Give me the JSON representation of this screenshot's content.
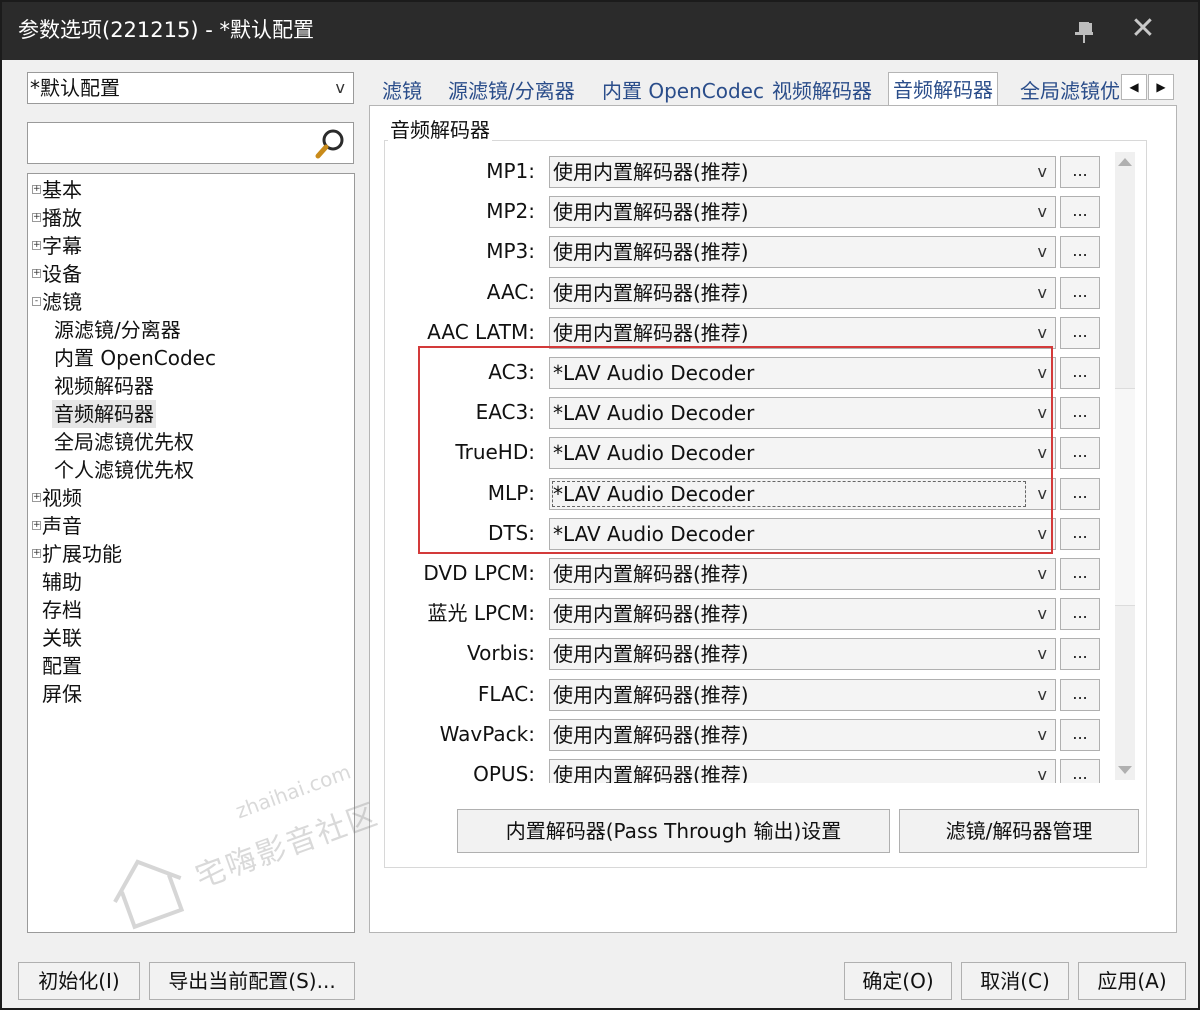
{
  "window": {
    "title": "参数选项(221215) - *默认配置"
  },
  "profile": {
    "selected": "*默认配置"
  },
  "search": {
    "placeholder": "",
    "value": ""
  },
  "tree": {
    "items": [
      {
        "label": "基本"
      },
      {
        "label": "播放"
      },
      {
        "label": "字幕"
      },
      {
        "label": "设备"
      },
      {
        "label": "滤镜"
      },
      {
        "label": "源滤镜/分离器"
      },
      {
        "label": "内置 OpenCodec"
      },
      {
        "label": "视频解码器"
      },
      {
        "label": "音频解码器"
      },
      {
        "label": "全局滤镜优先权"
      },
      {
        "label": "个人滤镜优先权"
      },
      {
        "label": "视频"
      },
      {
        "label": "声音"
      },
      {
        "label": "扩展功能"
      },
      {
        "label": "辅助"
      },
      {
        "label": "存档"
      },
      {
        "label": "关联"
      },
      {
        "label": "配置"
      },
      {
        "label": "屏保"
      }
    ]
  },
  "tabs": [
    {
      "label": "滤镜"
    },
    {
      "label": "源滤镜/分离器"
    },
    {
      "label": "内置 OpenCodec"
    },
    {
      "label": "视频解码器"
    },
    {
      "label": "音频解码器"
    },
    {
      "label": "全局滤镜优"
    }
  ],
  "group": {
    "title": "音频解码器"
  },
  "rows": [
    {
      "label": "MP1:",
      "value": "使用内置解码器(推荐)"
    },
    {
      "label": "MP2:",
      "value": "使用内置解码器(推荐)"
    },
    {
      "label": "MP3:",
      "value": "使用内置解码器(推荐)"
    },
    {
      "label": "AAC:",
      "value": "使用内置解码器(推荐)"
    },
    {
      "label": "AAC LATM:",
      "value": "使用内置解码器(推荐)"
    },
    {
      "label": "AC3:",
      "value": "*LAV Audio Decoder"
    },
    {
      "label": "EAC3:",
      "value": "*LAV Audio Decoder"
    },
    {
      "label": "TrueHD:",
      "value": "*LAV Audio Decoder"
    },
    {
      "label": "MLP:",
      "value": "*LAV Audio Decoder"
    },
    {
      "label": "DTS:",
      "value": "*LAV Audio Decoder"
    },
    {
      "label": "DVD LPCM:",
      "value": "使用内置解码器(推荐)"
    },
    {
      "label": "蓝光 LPCM:",
      "value": "使用内置解码器(推荐)"
    },
    {
      "label": "Vorbis:",
      "value": "使用内置解码器(推荐)"
    },
    {
      "label": "FLAC:",
      "value": "使用内置解码器(推荐)"
    },
    {
      "label": "WavPack:",
      "value": "使用内置解码器(推荐)"
    },
    {
      "label": "OPUS:",
      "value": "使用内置解码器(推荐)"
    }
  ],
  "more_label": "...",
  "buttons": {
    "passthrough": "内置解码器(Pass Through 输出)设置",
    "manager": "滤镜/解码器管理"
  },
  "footer": {
    "init": "初始化(I)",
    "export": "导出当前配置(S)...",
    "ok": "确定(O)",
    "cancel": "取消(C)",
    "apply": "应用(A)"
  },
  "watermark": {
    "domain": "zhaihai.com",
    "name": "宅嗨影音社区"
  },
  "colors": {
    "highlight": "#d33a3a",
    "titlebar": "#2b2b2b",
    "tab_text": "#2a4d8a"
  }
}
